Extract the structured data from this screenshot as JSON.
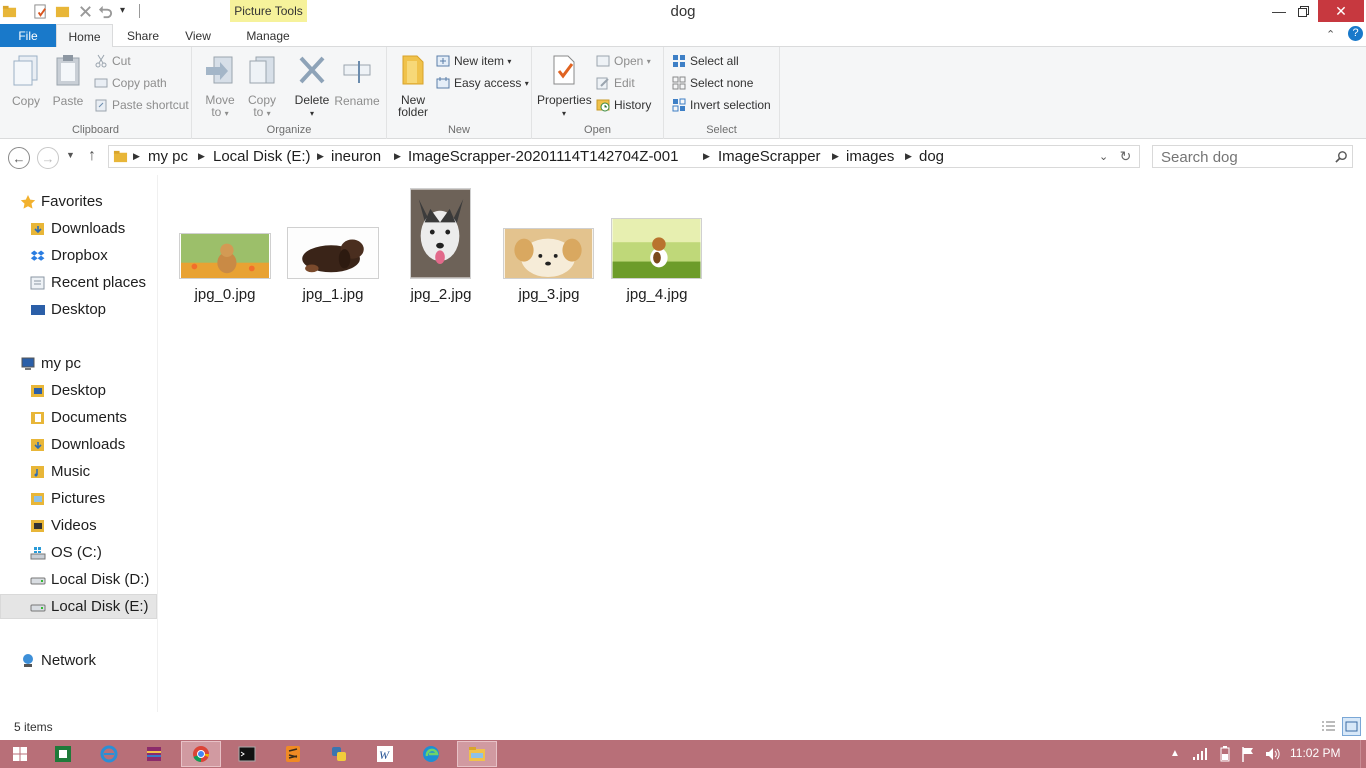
{
  "window": {
    "title": "dog",
    "contextual_tab_group": "Picture Tools"
  },
  "tabs": [
    {
      "label": "File"
    },
    {
      "label": "Home"
    },
    {
      "label": "Share"
    },
    {
      "label": "View"
    },
    {
      "label": "Manage"
    }
  ],
  "ribbon": {
    "clipboard": {
      "label": "Clipboard",
      "copy": "Copy",
      "paste": "Paste",
      "cut": "Cut",
      "copy_path": "Copy path",
      "paste_shortcut": "Paste shortcut"
    },
    "organize": {
      "label": "Organize",
      "move_to": [
        "Move",
        "to"
      ],
      "copy_to": [
        "Copy",
        "to"
      ],
      "delete": "Delete",
      "rename": "Rename"
    },
    "new": {
      "label": "New",
      "new_folder": [
        "New",
        "folder"
      ],
      "new_item": "New item",
      "easy_access": "Easy access"
    },
    "open": {
      "label": "Open",
      "properties": "Properties",
      "open": "Open",
      "edit": "Edit",
      "history": "History"
    },
    "select": {
      "label": "Select",
      "select_all": "Select all",
      "select_none": "Select none",
      "invert_selection": "Invert selection"
    }
  },
  "address": {
    "crumbs": [
      "my pc",
      "Local Disk (E:)",
      "ineuron",
      "ImageScrapper-20201114T142704Z-001",
      "ImageScrapper",
      "images",
      "dog"
    ]
  },
  "search": {
    "placeholder": "Search dog"
  },
  "navpane": {
    "favorites": {
      "label": "Favorites",
      "items": [
        "Downloads",
        "Dropbox",
        "Recent places",
        "Desktop"
      ]
    },
    "this_pc": {
      "label": "my pc",
      "items": [
        "Desktop",
        "Documents",
        "Downloads",
        "Music",
        "Pictures",
        "Videos",
        "OS (C:)",
        "Local Disk (D:)",
        "Local Disk (E:)"
      ]
    },
    "network": {
      "label": "Network"
    }
  },
  "files": [
    {
      "name": "jpg_0.jpg"
    },
    {
      "name": "jpg_1.jpg"
    },
    {
      "name": "jpg_2.jpg"
    },
    {
      "name": "jpg_3.jpg"
    },
    {
      "name": "jpg_4.jpg"
    }
  ],
  "status": {
    "item_count": "5 items"
  },
  "taskbar": {
    "clock": "11:02 PM"
  },
  "colors": {
    "file_tab": "#1979ca",
    "picture_tools": "#f6f29b",
    "taskbar": "#b86f78",
    "close_button": "#c7383f"
  }
}
